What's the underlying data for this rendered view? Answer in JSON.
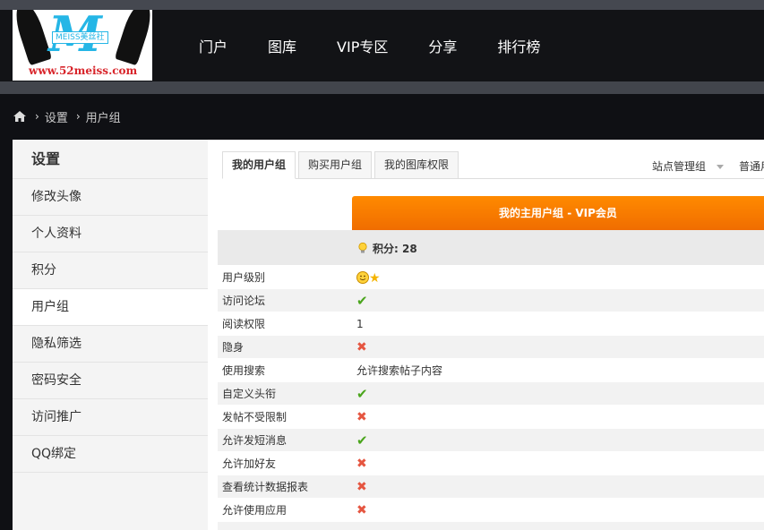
{
  "logo": {
    "tag": "MEISS美丝社",
    "url": "www.52meiss.com"
  },
  "nav": [
    "门户",
    "图库",
    "VIP专区",
    "分享",
    "排行榜"
  ],
  "breadcrumb": [
    "设置",
    "用户组"
  ],
  "sidebar": {
    "title": "设置",
    "items": [
      "修改头像",
      "个人资料",
      "积分",
      "用户组",
      "隐私筛选",
      "密码安全",
      "访问推广",
      "QQ绑定"
    ],
    "active_index": 3
  },
  "tabs": [
    "我的用户组",
    "购买用户组",
    "我的图库权限"
  ],
  "group_select": "站点管理组",
  "group_select2": "普通用",
  "group_header": "我的主用户组 - VIP会员",
  "points": "积分: 28",
  "permissions": [
    {
      "key": "用户级别",
      "value": "",
      "icon": "smile-star"
    },
    {
      "key": "访问论坛",
      "value": "",
      "icon": "check"
    },
    {
      "key": "阅读权限",
      "value": "1",
      "icon": ""
    },
    {
      "key": "隐身",
      "value": "",
      "icon": "cross"
    },
    {
      "key": "使用搜索",
      "value": "允许搜索帖子内容",
      "icon": ""
    },
    {
      "key": "自定义头衔",
      "value": "",
      "icon": "check"
    },
    {
      "key": "发帖不受限制",
      "value": "",
      "icon": "cross"
    },
    {
      "key": "允许发短消息",
      "value": "",
      "icon": "check"
    },
    {
      "key": "允许加好友",
      "value": "",
      "icon": "cross"
    },
    {
      "key": "查看统计数据报表",
      "value": "",
      "icon": "cross"
    },
    {
      "key": "允许使用应用",
      "value": "",
      "icon": "cross"
    }
  ],
  "colors": {
    "accent": "#ff7f00",
    "check": "#4aa51c",
    "cross": "#e55540"
  }
}
